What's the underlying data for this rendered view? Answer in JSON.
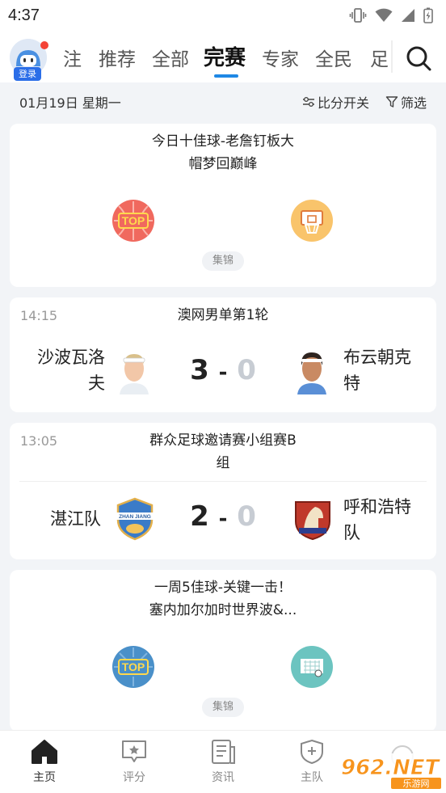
{
  "status": {
    "time": "4:37"
  },
  "nav": {
    "login_label": "登录",
    "tabs": [
      {
        "label": "注"
      },
      {
        "label": "推荐"
      },
      {
        "label": "全部"
      },
      {
        "label": "完赛",
        "active": true
      },
      {
        "label": "专家"
      },
      {
        "label": "全民"
      },
      {
        "label": "足"
      }
    ]
  },
  "date_row": {
    "date": "01月19日 星期一",
    "score_toggle": "比分开关",
    "filter": "筛选"
  },
  "highlight_1": {
    "title_line1": "今日十佳球-老詹钉板大",
    "title_line2": "帽梦回巅峰",
    "tag": "集锦",
    "logo_left_text": "TOP"
  },
  "match_1": {
    "time": "14:15",
    "title": "澳网男单第1轮",
    "home_name_line1": "沙波瓦洛",
    "home_name_line2": "夫",
    "away_name_line1": "布云朝克",
    "away_name_line2": "特",
    "home_score": "3",
    "away_score": "0",
    "score_sep": "-"
  },
  "match_2": {
    "time": "13:05",
    "title_line1": "群众足球邀请赛小组赛B",
    "title_line2": "组",
    "home_name": "湛江队",
    "away_name_line1": "呼和浩特",
    "away_name_line2": "队",
    "home_logo_text": "ZHAN JIANG",
    "home_score": "2",
    "away_score": "0",
    "score_sep": "-"
  },
  "highlight_2": {
    "title_line1": "一周5佳球-关键一击！",
    "title_line2": "塞内加尔加时世界波&...",
    "tag": "集锦",
    "logo_left_text": "TOP"
  },
  "bottom_nav": [
    {
      "label": "主页",
      "active": true
    },
    {
      "label": "评分"
    },
    {
      "label": "资讯"
    },
    {
      "label": "主队"
    }
  ],
  "watermark": {
    "text": "962.NET",
    "sub": "乐游网"
  },
  "colors": {
    "accent": "#1e88e5",
    "login_badge": "#2b6ee8",
    "notify_dot": "#f44336"
  }
}
